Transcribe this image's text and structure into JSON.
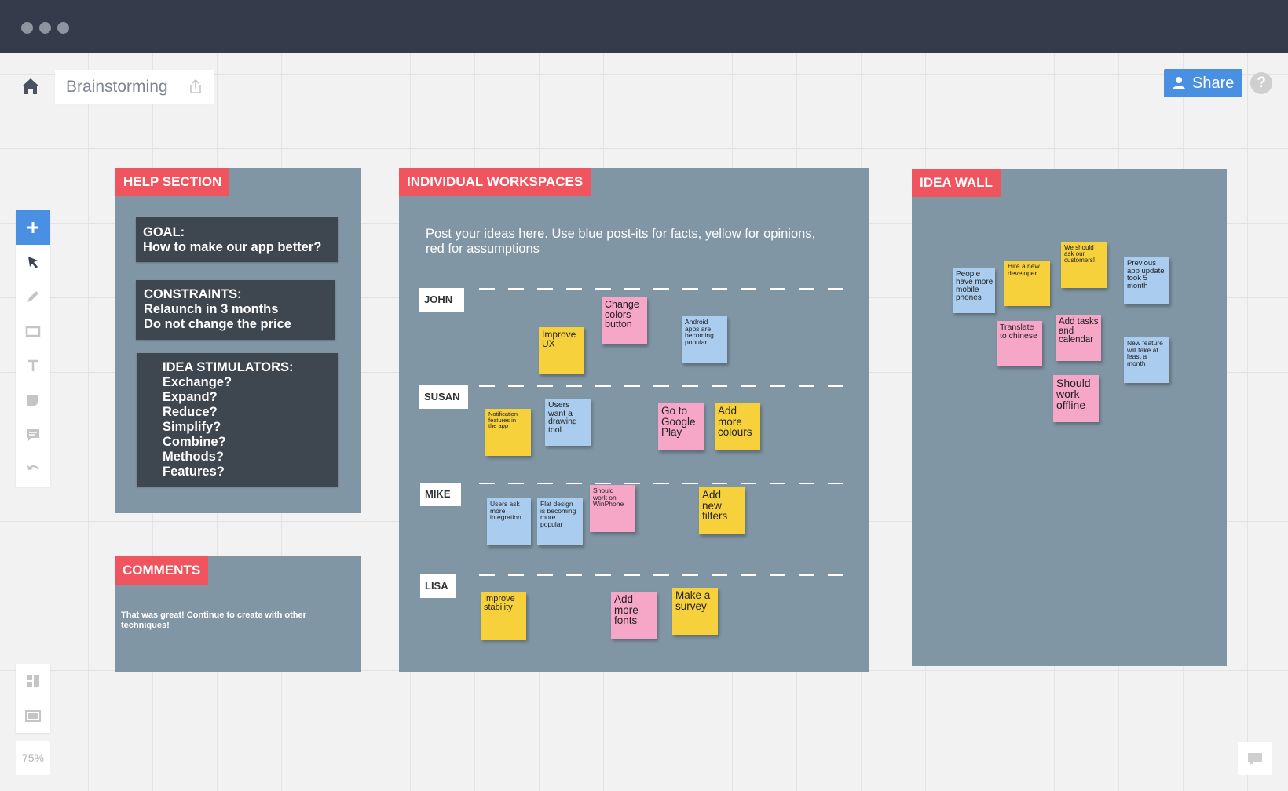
{
  "window": {
    "dots": [
      "",
      "",
      ""
    ]
  },
  "header": {
    "board_title": "Brainstorming",
    "share_label": "Share",
    "help_label": "?",
    "icons": {
      "home": "home-icon",
      "export": "export-icon",
      "user": "user-icon"
    }
  },
  "toolbar": {
    "tools": [
      "plus-icon",
      "cursor-icon",
      "pen-icon",
      "rectangle-icon",
      "text-icon",
      "sticky-note-icon",
      "comment-icon",
      "undo-icon"
    ],
    "bottom_tools": [
      "layout-icon",
      "frame-icon"
    ],
    "zoom_level": "75%"
  },
  "colors": {
    "accent": "#4a90e2",
    "frame": "#8196a4",
    "tag": "#f0545e",
    "yellow_note": "#f7d13c",
    "blue_note": "#a9ccef",
    "pink_note": "#f6a6c6"
  },
  "help_section": {
    "tag": "HELP SECTION",
    "goal": [
      "GOAL:",
      "How to make our app better?"
    ],
    "constraints": [
      "CONSTRAINTS:",
      "Relaunch in 3 months",
      "Do not change the price"
    ],
    "stimulators": [
      "IDEA STIMULATORS:",
      "Exchange?",
      "Expand?",
      "Reduce?",
      "Simplify?",
      "Combine?",
      "Methods?",
      "Features?"
    ]
  },
  "comments": {
    "tag": "COMMENTS",
    "text": [
      "That was great! Continue to create with other",
      "techniques!"
    ]
  },
  "workspaces": {
    "tag": "INDIVIDUAL WORKSPACES",
    "instructions": [
      "Post your ideas here. Use blue post-its for facts, yellow for opinions,",
      "red for assumptions"
    ],
    "rows": [
      "JOHN",
      "SUSAN",
      "MIKE",
      "LISA"
    ],
    "notes": {
      "john": [
        {
          "color": "yellow",
          "lines": [
            "Improve",
            "UX"
          ]
        },
        {
          "color": "pink",
          "lines": [
            "Change",
            "colors",
            "button"
          ]
        },
        {
          "color": "blue",
          "lines": [
            "Android",
            "apps are",
            "becoming",
            "popular"
          ]
        }
      ],
      "susan": [
        {
          "color": "yellow",
          "lines": [
            "Notification",
            "features in",
            "the app"
          ]
        },
        {
          "color": "blue",
          "lines": [
            "Users",
            "want a",
            "drawing",
            "tool"
          ]
        },
        {
          "color": "pink",
          "lines": [
            "Go to",
            "Google",
            "Play"
          ]
        },
        {
          "color": "yellow",
          "lines": [
            "Add",
            "more",
            "colours"
          ]
        }
      ],
      "mike": [
        {
          "color": "blue",
          "lines": [
            "Users ask",
            "more",
            "integration"
          ]
        },
        {
          "color": "blue",
          "lines": [
            "Flat design",
            "is becoming",
            "more",
            "popular"
          ]
        },
        {
          "color": "pink",
          "lines": [
            "Should",
            "work on",
            "WinPhone"
          ]
        },
        {
          "color": "yellow",
          "lines": [
            "Add",
            "new",
            "filters"
          ]
        }
      ],
      "lisa": [
        {
          "color": "yellow",
          "lines": [
            "Improve",
            "stability"
          ]
        },
        {
          "color": "pink",
          "lines": [
            "Add",
            "more",
            "fonts"
          ]
        },
        {
          "color": "yellow",
          "lines": [
            "Make a",
            "survey"
          ]
        }
      ]
    }
  },
  "idea_wall": {
    "tag": "IDEA WALL",
    "notes": [
      {
        "color": "blue",
        "lines": [
          "People",
          "have more",
          "mobile",
          "phones"
        ]
      },
      {
        "color": "yellow",
        "lines": [
          "Hire a new",
          "developer"
        ]
      },
      {
        "color": "yellow",
        "lines": [
          "We should",
          "ask our",
          "customers!"
        ]
      },
      {
        "color": "blue",
        "lines": [
          "Previous",
          "app update",
          "took 5",
          "month"
        ]
      },
      {
        "color": "pink",
        "lines": [
          "Translate",
          "to chinese"
        ]
      },
      {
        "color": "pink",
        "lines": [
          "Add tasks",
          "and",
          "calendar"
        ]
      },
      {
        "color": "blue",
        "lines": [
          "New feature",
          "will take at",
          "least a",
          "month"
        ]
      },
      {
        "color": "pink",
        "lines": [
          "Should",
          "work",
          "offline"
        ]
      }
    ]
  }
}
